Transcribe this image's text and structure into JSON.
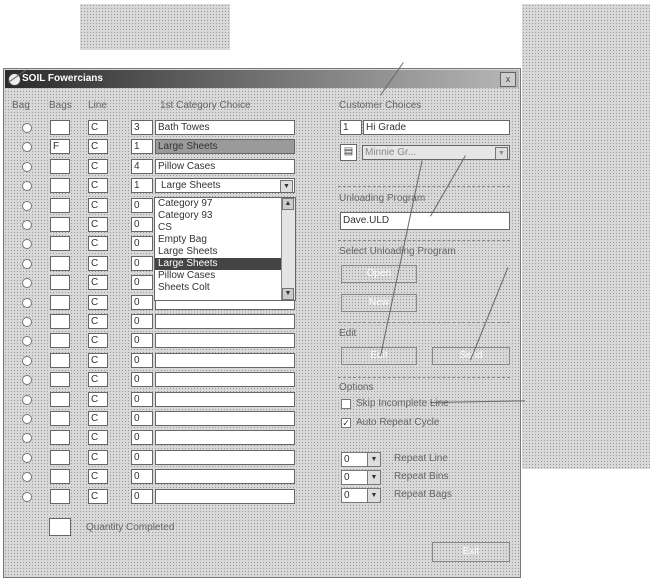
{
  "window": {
    "title": "SOIL Fowercians",
    "close_label": "x"
  },
  "headers": {
    "bag": "Bag",
    "bags": "Bags",
    "line": "Line",
    "category": "1st Category Choice"
  },
  "rows": [
    {
      "bags": "",
      "line": "C",
      "qty": "3",
      "category": "Bath Towes"
    },
    {
      "bags": "F",
      "line": "C",
      "qty": "1",
      "category": "Large Sheets"
    },
    {
      "bags": "",
      "line": "C",
      "qty": "4",
      "category": "Pillow Cases"
    },
    {
      "bags": "",
      "line": "C",
      "qty": "1",
      "category": "Large Sheets"
    },
    {
      "bags": "",
      "line": "C",
      "qty": "0",
      "category": ""
    },
    {
      "bags": "",
      "line": "C",
      "qty": "0",
      "category": ""
    },
    {
      "bags": "",
      "line": "C",
      "qty": "0",
      "category": ""
    },
    {
      "bags": "",
      "line": "C",
      "qty": "0",
      "category": ""
    },
    {
      "bags": "",
      "line": "C",
      "qty": "0",
      "category": ""
    },
    {
      "bags": "",
      "line": "C",
      "qty": "0",
      "category": ""
    },
    {
      "bags": "",
      "line": "C",
      "qty": "0",
      "category": ""
    },
    {
      "bags": "",
      "line": "C",
      "qty": "0",
      "category": ""
    },
    {
      "bags": "",
      "line": "C",
      "qty": "0",
      "category": ""
    },
    {
      "bags": "",
      "line": "C",
      "qty": "0",
      "category": ""
    },
    {
      "bags": "",
      "line": "C",
      "qty": "0",
      "category": ""
    },
    {
      "bags": "",
      "line": "C",
      "qty": "0",
      "category": ""
    },
    {
      "bags": "",
      "line": "C",
      "qty": "0",
      "category": ""
    },
    {
      "bags": "",
      "line": "C",
      "qty": "0",
      "category": ""
    },
    {
      "bags": "",
      "line": "C",
      "qty": "0",
      "category": ""
    },
    {
      "bags": "",
      "line": "C",
      "qty": "0",
      "category": ""
    }
  ],
  "dropdown_list": [
    "Category 97",
    "Category 93",
    "CS",
    "Empty Bag",
    "Large Sheets",
    "Large Sheets",
    "Pillow Cases",
    "Sheets Colt"
  ],
  "quantity_completed": {
    "label": "Quantity Completed",
    "value": ""
  },
  "customer_choices": {
    "label": "Customer Choices",
    "number": "1",
    "grade": "Hi Grade",
    "combo_value": "Minnie Gr..."
  },
  "unloading_program": {
    "label": "Unloading Program",
    "value": "Dave.ULD"
  },
  "select_program": {
    "label": "Select Unloading Program",
    "open_button": "Open",
    "new_button": "New"
  },
  "edit": {
    "label": "Edit",
    "edit_button": "Edit",
    "send_button": "Send"
  },
  "options": {
    "label": "Options",
    "skip_label": "Skip Incomplete Line",
    "skip_checked": "",
    "auto_label": "Auto Repeat Cycle",
    "auto_checked": "✓"
  },
  "spinners": [
    {
      "value": "0",
      "label": "Repeat Line"
    },
    {
      "value": "0",
      "label": "Repeat Bins"
    },
    {
      "value": "0",
      "label": "Repeat Bags"
    }
  ],
  "exit_button": "Exit"
}
